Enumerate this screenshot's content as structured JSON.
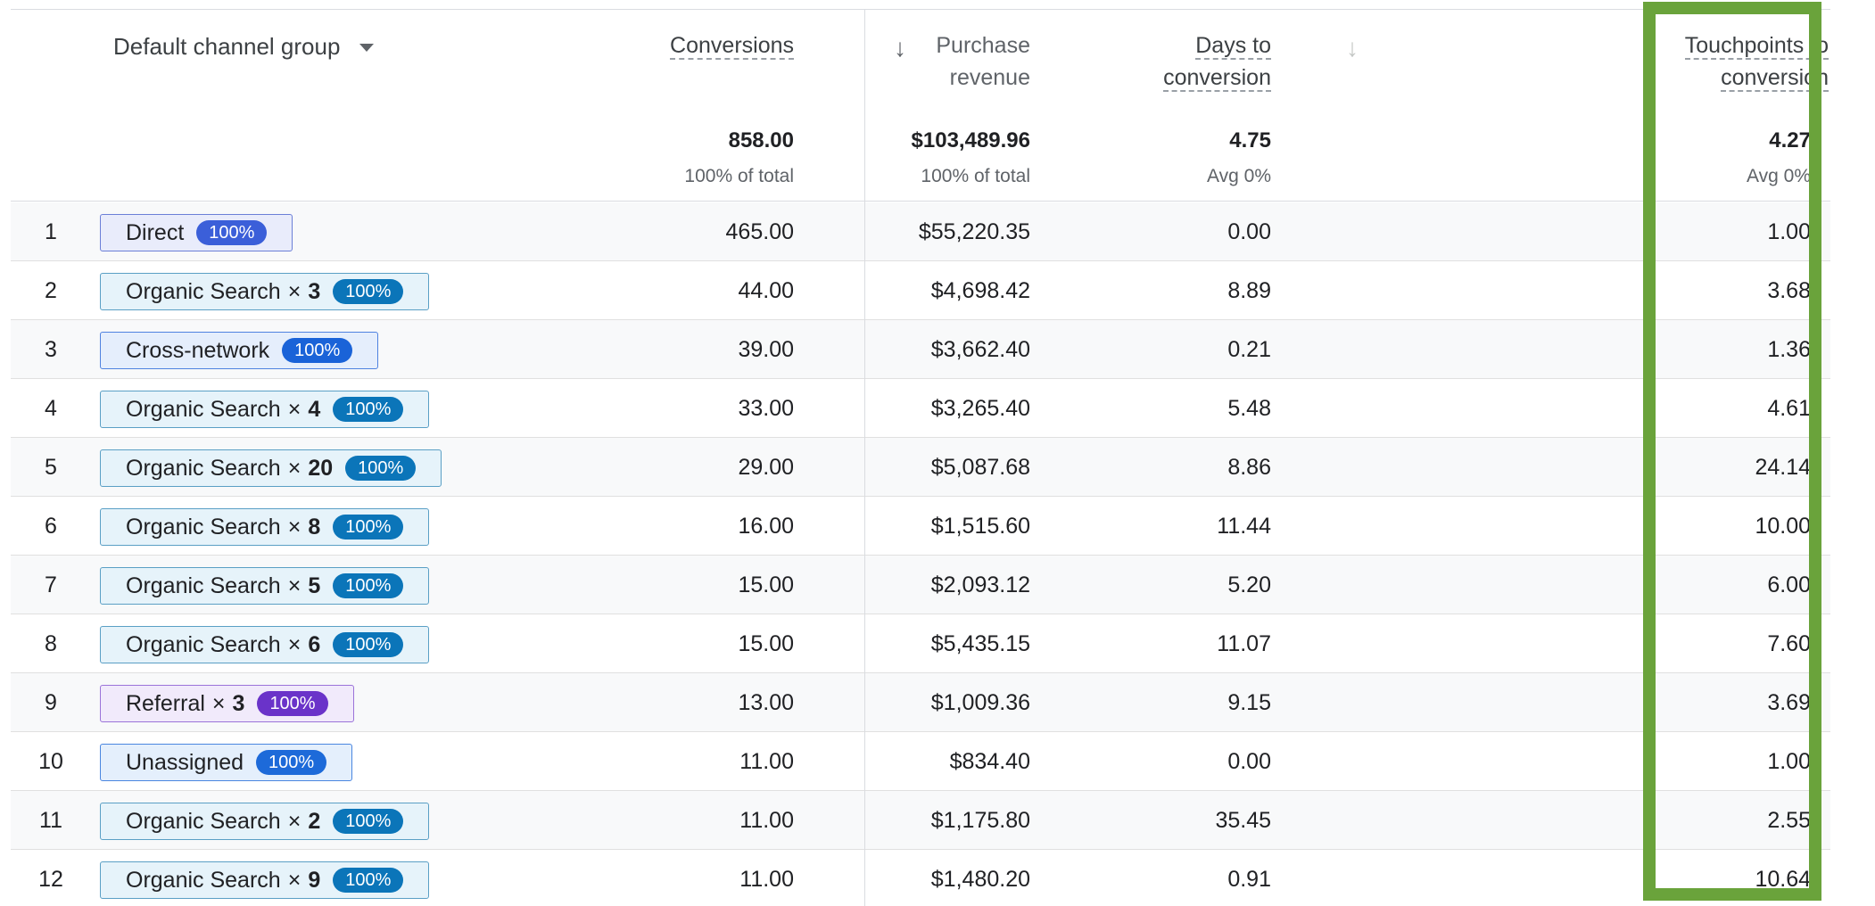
{
  "header": {
    "dimension_label": "Default channel group",
    "columns": [
      {
        "line1": "Conversions",
        "line2": "",
        "total": "858.00",
        "sub": "100% of total"
      },
      {
        "line1": "Purchase",
        "line2": "revenue",
        "total": "$103,489.96",
        "sub": "100% of total"
      },
      {
        "line1": "Days to",
        "line2": "conversion",
        "total": "4.75",
        "sub": "Avg 0%"
      },
      {
        "line1": "Touchpoints to",
        "line2": "conversion",
        "total": "4.27",
        "sub": "Avg 0%"
      }
    ],
    "sort_arrow_glyph": "↓"
  },
  "rows": [
    {
      "num": "1",
      "channel": "Direct",
      "times": "",
      "count": "",
      "pct": "100%",
      "kind": "direct",
      "conversions": "465.00",
      "revenue": "$55,220.35",
      "days": "0.00",
      "touchpoints": "1.00"
    },
    {
      "num": "2",
      "channel": "Organic Search",
      "times": "×",
      "count": "3",
      "pct": "100%",
      "kind": "organic",
      "conversions": "44.00",
      "revenue": "$4,698.42",
      "days": "8.89",
      "touchpoints": "3.68"
    },
    {
      "num": "3",
      "channel": "Cross-network",
      "times": "",
      "count": "",
      "pct": "100%",
      "kind": "cross",
      "conversions": "39.00",
      "revenue": "$3,662.40",
      "days": "0.21",
      "touchpoints": "1.36"
    },
    {
      "num": "4",
      "channel": "Organic Search",
      "times": "×",
      "count": "4",
      "pct": "100%",
      "kind": "organic",
      "conversions": "33.00",
      "revenue": "$3,265.40",
      "days": "5.48",
      "touchpoints": "4.61"
    },
    {
      "num": "5",
      "channel": "Organic Search",
      "times": "×",
      "count": "20",
      "pct": "100%",
      "kind": "organic",
      "conversions": "29.00",
      "revenue": "$5,087.68",
      "days": "8.86",
      "touchpoints": "24.14"
    },
    {
      "num": "6",
      "channel": "Organic Search",
      "times": "×",
      "count": "8",
      "pct": "100%",
      "kind": "organic",
      "conversions": "16.00",
      "revenue": "$1,515.60",
      "days": "11.44",
      "touchpoints": "10.00"
    },
    {
      "num": "7",
      "channel": "Organic Search",
      "times": "×",
      "count": "5",
      "pct": "100%",
      "kind": "organic",
      "conversions": "15.00",
      "revenue": "$2,093.12",
      "days": "5.20",
      "touchpoints": "6.00"
    },
    {
      "num": "8",
      "channel": "Organic Search",
      "times": "×",
      "count": "6",
      "pct": "100%",
      "kind": "organic",
      "conversions": "15.00",
      "revenue": "$5,435.15",
      "days": "11.07",
      "touchpoints": "7.60"
    },
    {
      "num": "9",
      "channel": "Referral",
      "times": "×",
      "count": "3",
      "pct": "100%",
      "kind": "referral",
      "conversions": "13.00",
      "revenue": "$1,009.36",
      "days": "9.15",
      "touchpoints": "3.69"
    },
    {
      "num": "10",
      "channel": "Unassigned",
      "times": "",
      "count": "",
      "pct": "100%",
      "kind": "unassigned",
      "conversions": "11.00",
      "revenue": "$834.40",
      "days": "0.00",
      "touchpoints": "1.00"
    },
    {
      "num": "11",
      "channel": "Organic Search",
      "times": "×",
      "count": "2",
      "pct": "100%",
      "kind": "organic",
      "conversions": "11.00",
      "revenue": "$1,175.80",
      "days": "35.45",
      "touchpoints": "2.55"
    },
    {
      "num": "12",
      "channel": "Organic Search",
      "times": "×",
      "count": "9",
      "pct": "100%",
      "kind": "organic",
      "conversions": "11.00",
      "revenue": "$1,480.20",
      "days": "0.91",
      "touchpoints": "10.64"
    }
  ],
  "colors": {
    "highlight_border": "#6aa33b",
    "organic_badge": "#0b75b9",
    "direct_badge": "#3b5fd9",
    "cross_network_badge": "#1a63d8",
    "referral_badge": "#6a33c9",
    "unassigned_badge": "#1d6ad9"
  }
}
